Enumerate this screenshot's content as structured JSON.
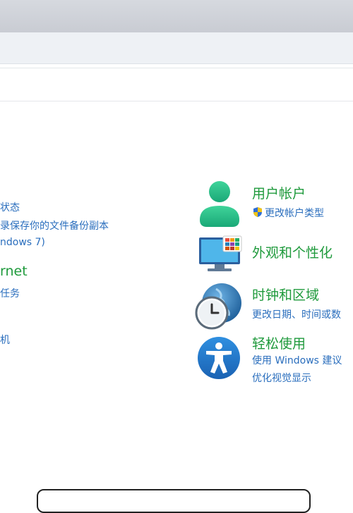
{
  "left_column": {
    "line1": "状态",
    "line2": "录保存你的文件备份副本",
    "line3": "ndows 7)",
    "heading_partial": "rnet",
    "line4": "任务",
    "line5": "机"
  },
  "right_column": {
    "user_accounts": {
      "title": "用户帐户",
      "link": "更改帐户类型",
      "icon": "user-icon"
    },
    "appearance": {
      "title": "外观和个性化",
      "icon": "monitor-icon"
    },
    "clock_region": {
      "title": "时钟和区域",
      "link": "更改日期、时间或数",
      "icon": "clock-globe-icon"
    },
    "ease_of_access": {
      "title": "轻松使用",
      "link1": "使用 Windows 建议",
      "link2": "优化视觉显示",
      "icon": "accessibility-icon"
    }
  },
  "colors": {
    "heading_green": "#1f9a3c",
    "link_blue": "#2a6ebd"
  }
}
